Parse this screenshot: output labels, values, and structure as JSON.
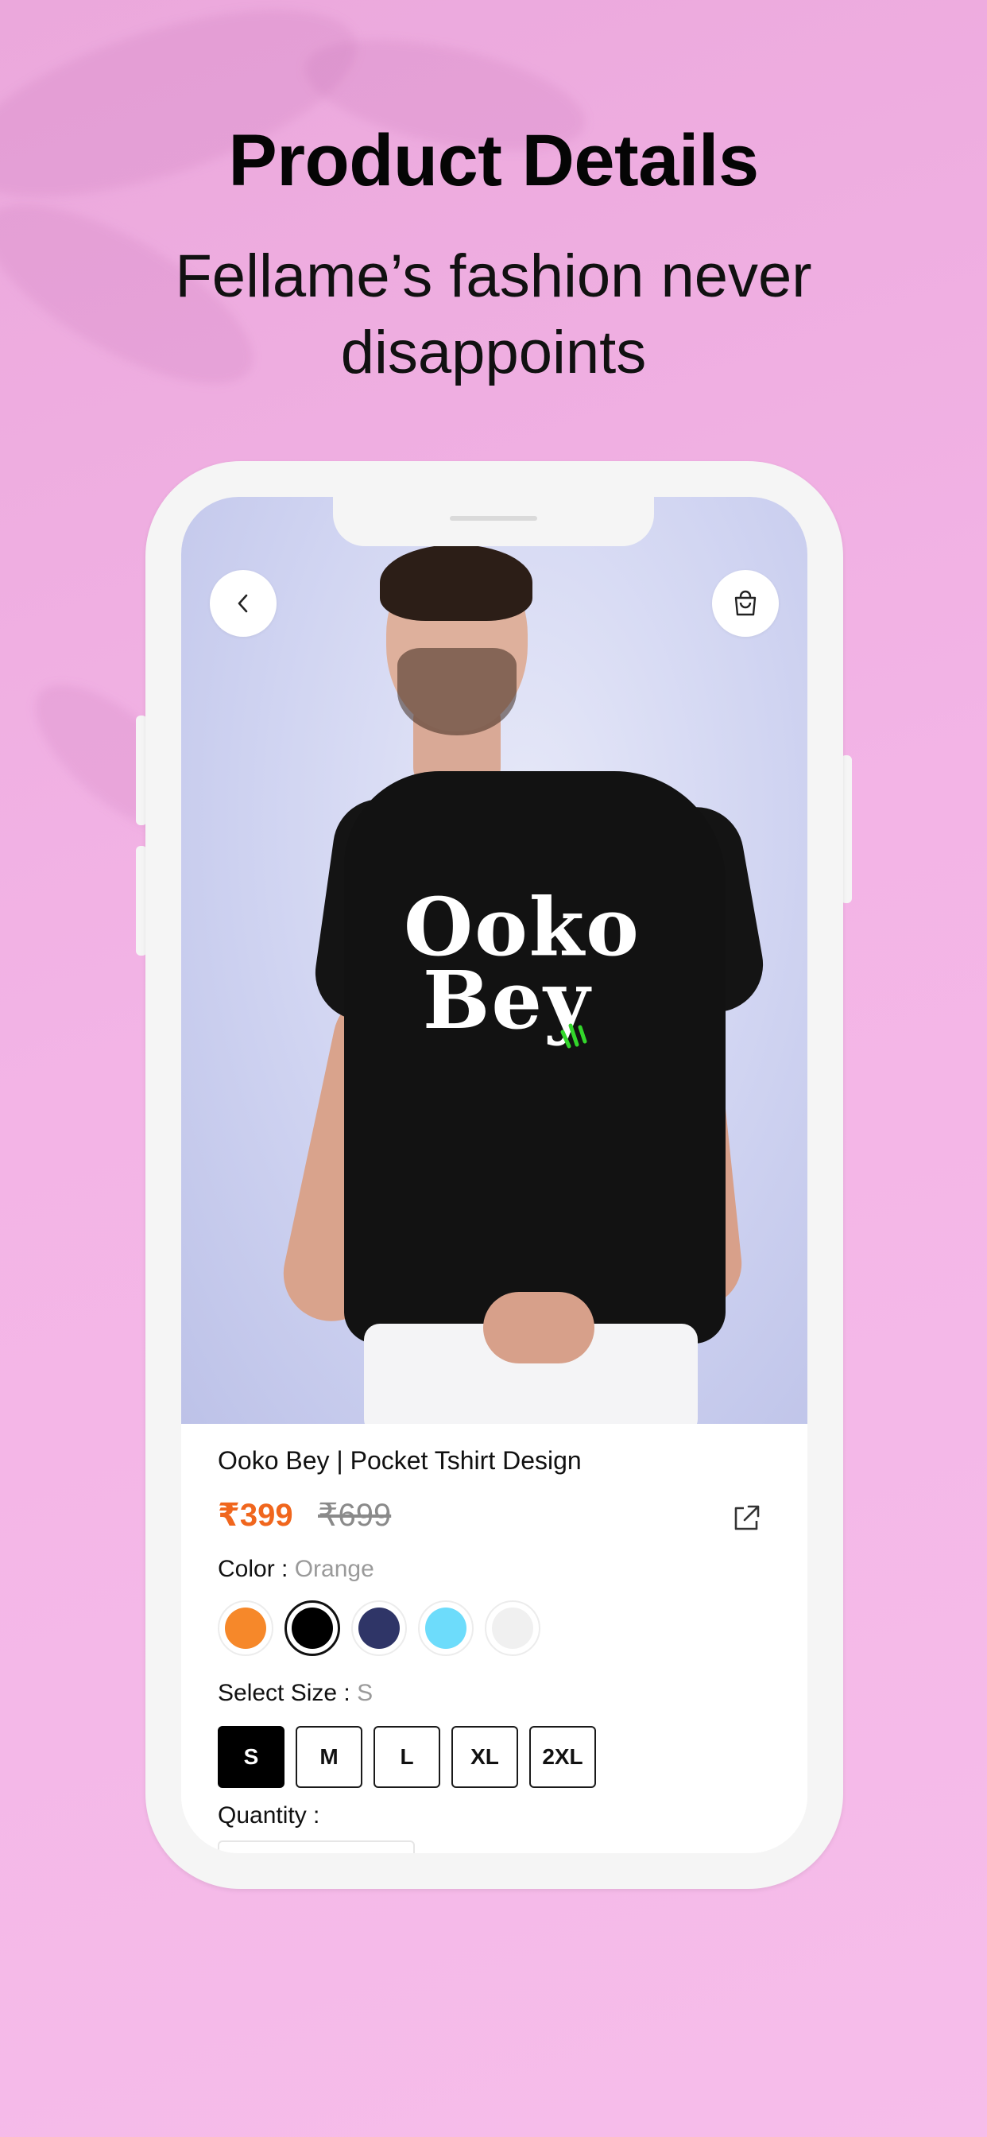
{
  "promo": {
    "headline": "Product Details",
    "subheadline": "Fellame’s fashion never disappoints"
  },
  "header": {
    "back_icon": "chevron-left-icon",
    "cart_icon": "shopping-bag-icon"
  },
  "product": {
    "image_print_line1": "Ooko",
    "image_print_line2": "Bey",
    "title": "Ooko Bey | Pocket Tshirt Design",
    "price": "₹399",
    "original_price": "₹699",
    "share_icon": "external-link-icon",
    "color_label": "Color : ",
    "color_value": "Orange",
    "colors": [
      "#f6882a",
      "#000000",
      "#2f3567",
      "#6ddcfb",
      "#f0f0f0"
    ],
    "selected_color_index": 1,
    "size_label": "Select Size : ",
    "size_value": "S",
    "sizes": [
      "S",
      "M",
      "L",
      "XL",
      "2XL"
    ],
    "selected_size": "S",
    "quantity_label": "Quantity :"
  },
  "colors": {
    "background": "#f3b4e6",
    "price": "#f0661d",
    "accent_green": "#33d62b"
  }
}
